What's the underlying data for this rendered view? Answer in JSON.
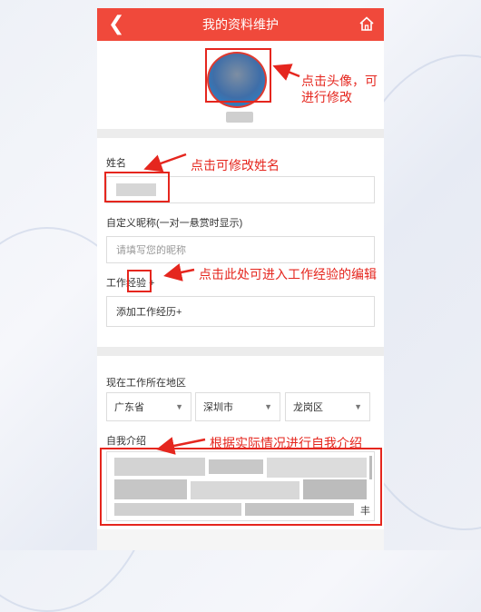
{
  "header": {
    "title": "我的资料维护",
    "back_icon": "chevron-left-icon",
    "home_icon": "home-icon"
  },
  "colors": {
    "brand": "#f0493b",
    "annotation": "#e5261e"
  },
  "form": {
    "name_label": "姓名",
    "nickname_label": "自定义昵称(一对一悬赏时显示)",
    "nickname_placeholder": "请填写您的昵称",
    "work_label": "工作经验 +",
    "add_work": "添加工作经历+",
    "region_label": "现在工作所在地区",
    "province": "广东省",
    "city": "深圳市",
    "district": "龙岗区",
    "intro_label": "自我介绍",
    "intro_tail": "丰"
  },
  "annotations": {
    "avatar_line1": "点击头像，可",
    "avatar_line2": "进行修改",
    "name": "点击可修改姓名",
    "work": "点击此处可进入工作经验的编辑",
    "intro": "根据实际情况进行自我介绍"
  }
}
